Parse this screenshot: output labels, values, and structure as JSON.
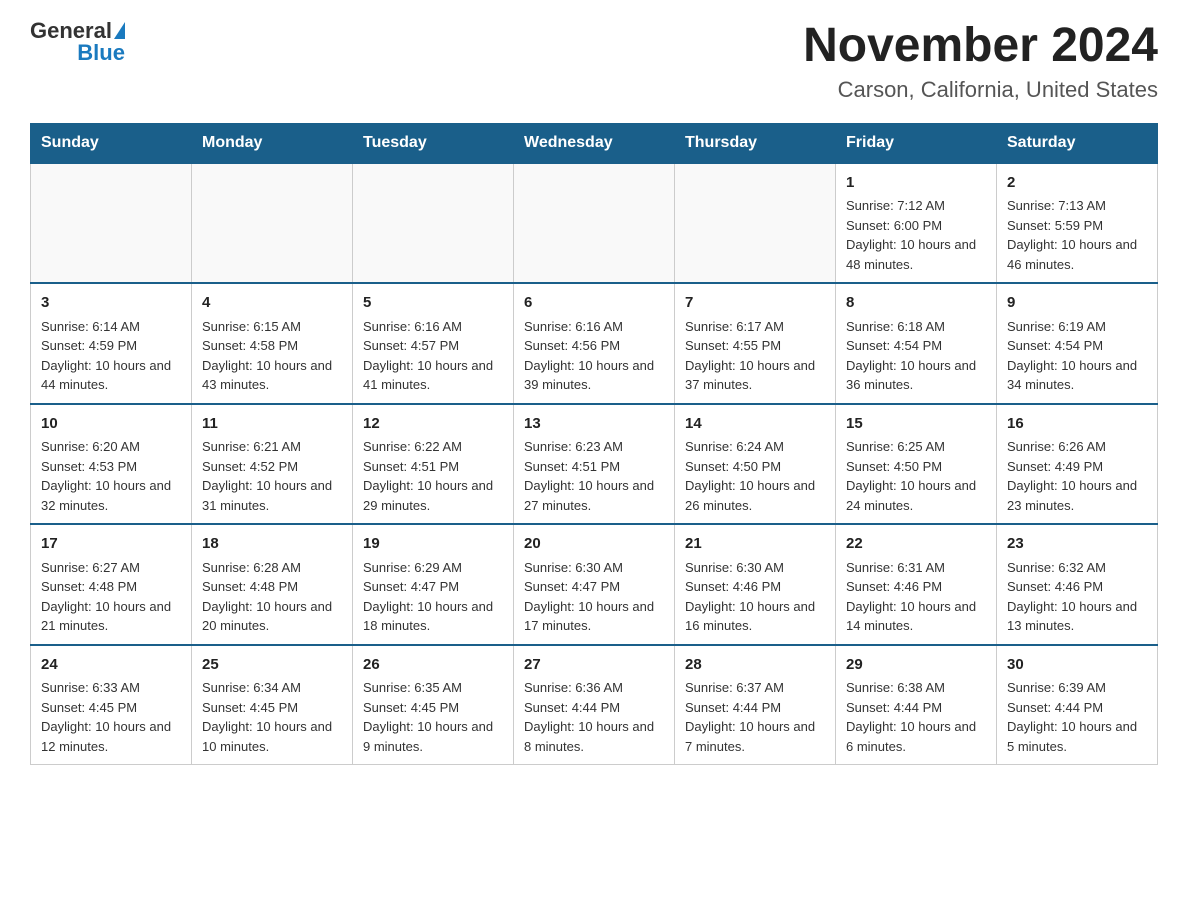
{
  "header": {
    "logo_general": "General",
    "logo_blue": "Blue",
    "title": "November 2024",
    "subtitle": "Carson, California, United States"
  },
  "days_of_week": [
    "Sunday",
    "Monday",
    "Tuesday",
    "Wednesday",
    "Thursday",
    "Friday",
    "Saturday"
  ],
  "weeks": [
    [
      {
        "day": "",
        "info": ""
      },
      {
        "day": "",
        "info": ""
      },
      {
        "day": "",
        "info": ""
      },
      {
        "day": "",
        "info": ""
      },
      {
        "day": "",
        "info": ""
      },
      {
        "day": "1",
        "info": "Sunrise: 7:12 AM\nSunset: 6:00 PM\nDaylight: 10 hours and 48 minutes."
      },
      {
        "day": "2",
        "info": "Sunrise: 7:13 AM\nSunset: 5:59 PM\nDaylight: 10 hours and 46 minutes."
      }
    ],
    [
      {
        "day": "3",
        "info": "Sunrise: 6:14 AM\nSunset: 4:59 PM\nDaylight: 10 hours and 44 minutes."
      },
      {
        "day": "4",
        "info": "Sunrise: 6:15 AM\nSunset: 4:58 PM\nDaylight: 10 hours and 43 minutes."
      },
      {
        "day": "5",
        "info": "Sunrise: 6:16 AM\nSunset: 4:57 PM\nDaylight: 10 hours and 41 minutes."
      },
      {
        "day": "6",
        "info": "Sunrise: 6:16 AM\nSunset: 4:56 PM\nDaylight: 10 hours and 39 minutes."
      },
      {
        "day": "7",
        "info": "Sunrise: 6:17 AM\nSunset: 4:55 PM\nDaylight: 10 hours and 37 minutes."
      },
      {
        "day": "8",
        "info": "Sunrise: 6:18 AM\nSunset: 4:54 PM\nDaylight: 10 hours and 36 minutes."
      },
      {
        "day": "9",
        "info": "Sunrise: 6:19 AM\nSunset: 4:54 PM\nDaylight: 10 hours and 34 minutes."
      }
    ],
    [
      {
        "day": "10",
        "info": "Sunrise: 6:20 AM\nSunset: 4:53 PM\nDaylight: 10 hours and 32 minutes."
      },
      {
        "day": "11",
        "info": "Sunrise: 6:21 AM\nSunset: 4:52 PM\nDaylight: 10 hours and 31 minutes."
      },
      {
        "day": "12",
        "info": "Sunrise: 6:22 AM\nSunset: 4:51 PM\nDaylight: 10 hours and 29 minutes."
      },
      {
        "day": "13",
        "info": "Sunrise: 6:23 AM\nSunset: 4:51 PM\nDaylight: 10 hours and 27 minutes."
      },
      {
        "day": "14",
        "info": "Sunrise: 6:24 AM\nSunset: 4:50 PM\nDaylight: 10 hours and 26 minutes."
      },
      {
        "day": "15",
        "info": "Sunrise: 6:25 AM\nSunset: 4:50 PM\nDaylight: 10 hours and 24 minutes."
      },
      {
        "day": "16",
        "info": "Sunrise: 6:26 AM\nSunset: 4:49 PM\nDaylight: 10 hours and 23 minutes."
      }
    ],
    [
      {
        "day": "17",
        "info": "Sunrise: 6:27 AM\nSunset: 4:48 PM\nDaylight: 10 hours and 21 minutes."
      },
      {
        "day": "18",
        "info": "Sunrise: 6:28 AM\nSunset: 4:48 PM\nDaylight: 10 hours and 20 minutes."
      },
      {
        "day": "19",
        "info": "Sunrise: 6:29 AM\nSunset: 4:47 PM\nDaylight: 10 hours and 18 minutes."
      },
      {
        "day": "20",
        "info": "Sunrise: 6:30 AM\nSunset: 4:47 PM\nDaylight: 10 hours and 17 minutes."
      },
      {
        "day": "21",
        "info": "Sunrise: 6:30 AM\nSunset: 4:46 PM\nDaylight: 10 hours and 16 minutes."
      },
      {
        "day": "22",
        "info": "Sunrise: 6:31 AM\nSunset: 4:46 PM\nDaylight: 10 hours and 14 minutes."
      },
      {
        "day": "23",
        "info": "Sunrise: 6:32 AM\nSunset: 4:46 PM\nDaylight: 10 hours and 13 minutes."
      }
    ],
    [
      {
        "day": "24",
        "info": "Sunrise: 6:33 AM\nSunset: 4:45 PM\nDaylight: 10 hours and 12 minutes."
      },
      {
        "day": "25",
        "info": "Sunrise: 6:34 AM\nSunset: 4:45 PM\nDaylight: 10 hours and 10 minutes."
      },
      {
        "day": "26",
        "info": "Sunrise: 6:35 AM\nSunset: 4:45 PM\nDaylight: 10 hours and 9 minutes."
      },
      {
        "day": "27",
        "info": "Sunrise: 6:36 AM\nSunset: 4:44 PM\nDaylight: 10 hours and 8 minutes."
      },
      {
        "day": "28",
        "info": "Sunrise: 6:37 AM\nSunset: 4:44 PM\nDaylight: 10 hours and 7 minutes."
      },
      {
        "day": "29",
        "info": "Sunrise: 6:38 AM\nSunset: 4:44 PM\nDaylight: 10 hours and 6 minutes."
      },
      {
        "day": "30",
        "info": "Sunrise: 6:39 AM\nSunset: 4:44 PM\nDaylight: 10 hours and 5 minutes."
      }
    ]
  ]
}
